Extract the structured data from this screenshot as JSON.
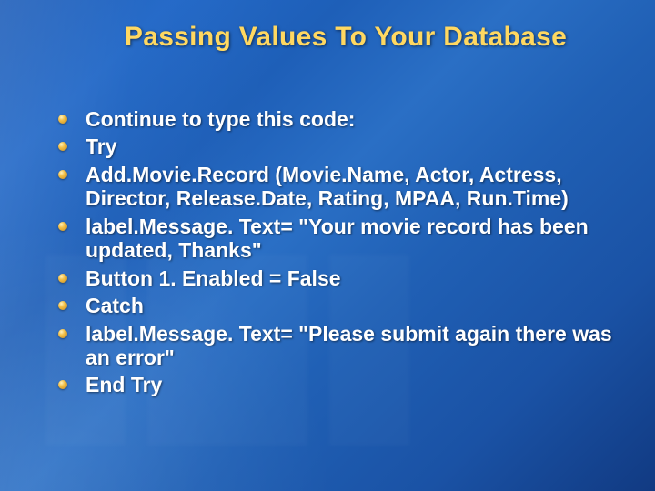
{
  "slide": {
    "title": "Passing Values To Your Database",
    "bullets": [
      "Continue to type this code:",
      "Try",
      "Add.Movie.Record (Movie.Name, Actor, Actress, Director, Release.Date, Rating, MPAA, Run.Time)",
      "label.Message. Text= \"Your movie record has been updated, Thanks\"",
      "Button 1. Enabled = False",
      "Catch",
      "label.Message. Text= \"Please submit again there was an error\"",
      "End Try"
    ]
  }
}
